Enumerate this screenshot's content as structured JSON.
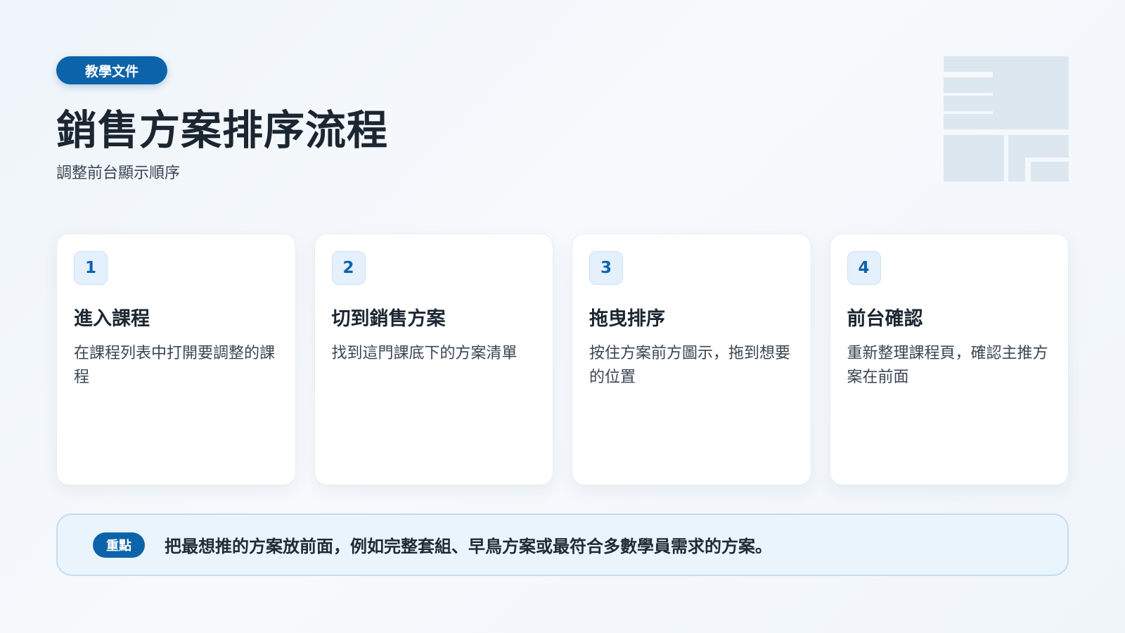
{
  "header": {
    "tag": "教學文件",
    "title": "銷售方案排序流程",
    "subtitle": "調整前台顯示順序"
  },
  "steps": [
    {
      "number": "1",
      "title": "進入課程",
      "description": "在課程列表中打開要調整的課程"
    },
    {
      "number": "2",
      "title": "切到銷售方案",
      "description": "找到這門課底下的方案清單"
    },
    {
      "number": "3",
      "title": "拖曳排序",
      "description": "按住方案前方圖示，拖到想要的位置"
    },
    {
      "number": "4",
      "title": "前台確認",
      "description": "重新整理課程頁，確認主推方案在前面"
    }
  ],
  "note": {
    "badge": "重點",
    "text": "把最想推的方案放前面，例如完整套組、早鳥方案或最符合多數學員需求的方案。"
  },
  "colors": {
    "accent": "#0d63aa",
    "note_background": "#eaf4fc",
    "decoration": "#dde7f0"
  },
  "decoration_icon": "layout-grid-icon"
}
